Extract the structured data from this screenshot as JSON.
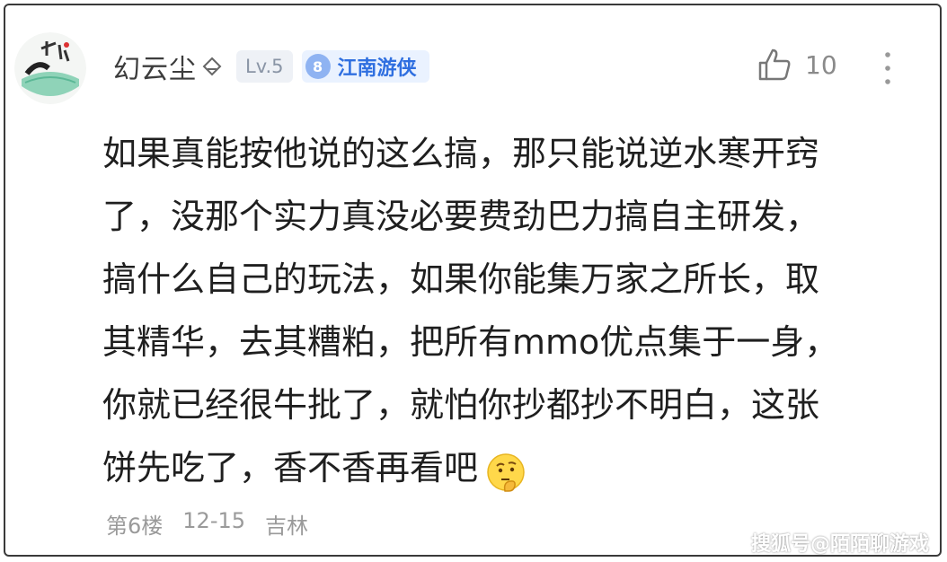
{
  "comment_card": {
    "user": {
      "name": "幻云尘",
      "level": "Lv.5",
      "honor_number": "8",
      "honor_title": "江南游侠",
      "avatar_icon": "avatar-cat-with-mask"
    },
    "likes": "10",
    "text_lines": [
      "如果真能按他说的这么搞，那只能说逆水寒开窍",
      "了，没那个实力真没必要费劲巴力搞自主研发，",
      "搞什么自己的玩法，如果你能集万家之所长，取",
      "其精华，去其糟粕，把所有mmo优点集于一身，",
      "你就已经很牛批了，就怕你抄都抄不明白，这张",
      "饼先吃了，香不香再看吧"
    ],
    "emoji_icon": "thinking-face-icon",
    "floor": "第6楼",
    "date": "12-15",
    "location": "吉林"
  },
  "watermark": "搜狐号@陌陌聊游戏",
  "colors": {
    "honor_blue": "#2f6fe0",
    "level_gray": "#8a95a6",
    "meta_gray": "#9a9a9a"
  }
}
